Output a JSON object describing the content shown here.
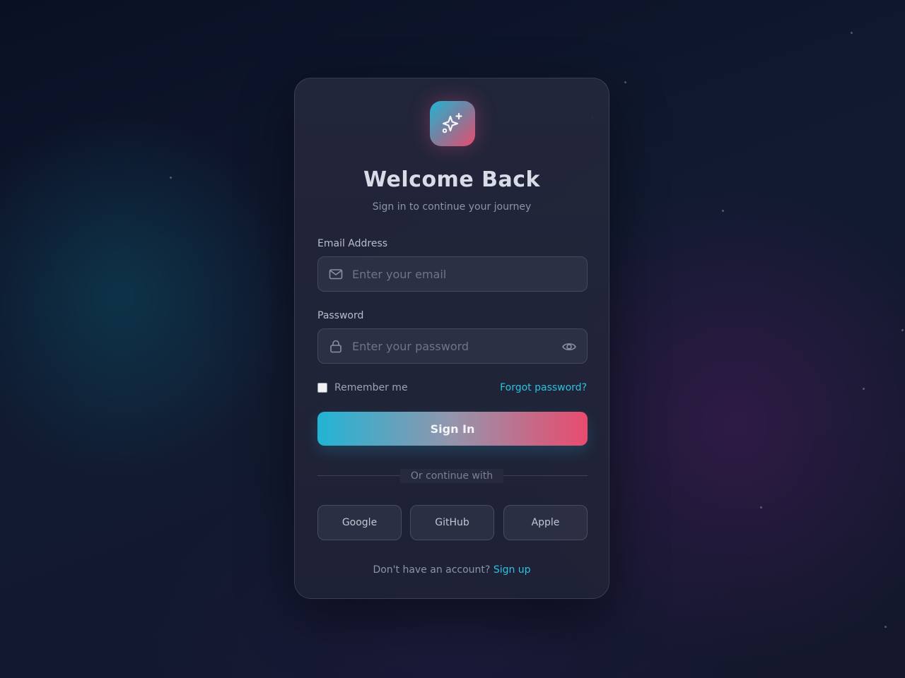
{
  "header": {
    "title": "Welcome Back",
    "subtitle": "Sign in to continue your journey"
  },
  "form": {
    "email_label": "Email Address",
    "email_placeholder": "Enter your email",
    "email_value": "",
    "password_label": "Password",
    "password_placeholder": "Enter your password",
    "password_value": "",
    "remember_label": "Remember me",
    "remember_checked": false,
    "forgot_link": "Forgot password?",
    "submit_label": "Sign In"
  },
  "divider": {
    "label": "Or continue with"
  },
  "social": [
    {
      "label": "Google"
    },
    {
      "label": "GitHub"
    },
    {
      "label": "Apple"
    }
  ],
  "footer": {
    "prompt": "Don't have an account?",
    "signup_link": "Sign up"
  },
  "icons": {
    "logo": "sparkles-icon",
    "email": "mail-icon",
    "password": "lock-icon",
    "toggle": "eye-icon"
  },
  "colors": {
    "accent_cyan": "#22b4d4",
    "accent_pink": "#e94b6e",
    "link": "#2cc2e0",
    "background": "#0c1222",
    "card": "#25283c"
  }
}
